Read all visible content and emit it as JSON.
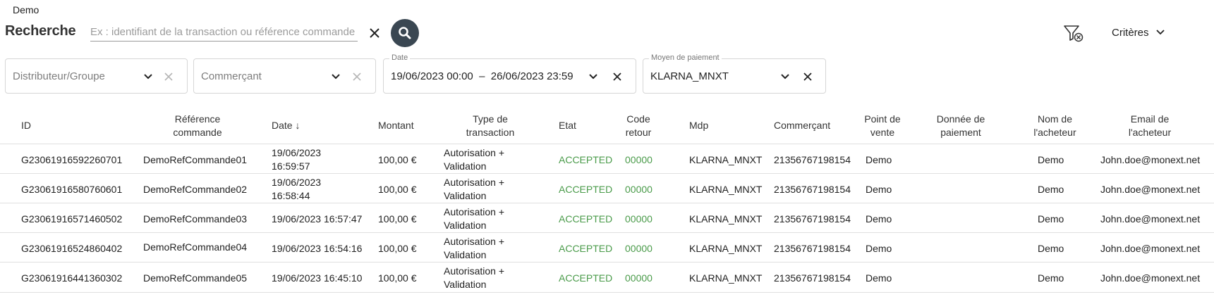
{
  "app": {
    "title": "Demo"
  },
  "search": {
    "label": "Recherche",
    "placeholder": "Ex : identifiant de la transaction ou référence commande",
    "value": ""
  },
  "toolbar": {
    "criteria_label": "Critères"
  },
  "filters": {
    "distributor": {
      "placeholder": "Distributeur/Groupe"
    },
    "merchant": {
      "placeholder": "Commerçant"
    },
    "date": {
      "label": "Date",
      "value": "19/06/2023 00:00  –  26/06/2023 23:59"
    },
    "payment": {
      "label": "Moyen de paiement",
      "value": "KLARNA_MNXT"
    }
  },
  "table": {
    "headers": {
      "id": "ID",
      "ref": "Référence commande",
      "date": "Date ↓",
      "amount": "Montant",
      "type": "Type de transaction",
      "state": "Etat",
      "code": "Code retour",
      "mdp": "Mdp",
      "merchant": "Commerçant",
      "pos": "Point de vente",
      "paydata": "Donnée de paiement",
      "buyer": "Nom de l'acheteur",
      "email": "Email de l'acheteur"
    },
    "rows": [
      {
        "id": "G23061916592260701",
        "ref": "DemoRefCommande01",
        "date": "19/06/2023 16:59:57",
        "date_l1": "19/06/2023",
        "date_l2": "16:59:57",
        "amount": "100,00 €",
        "type_l1": "Autorisation +",
        "type_l2": "Validation",
        "state": "ACCEPTED",
        "code": "00000",
        "mdp": "KLARNA_MNXT",
        "merchant": "21356767198154",
        "pos": "Demo",
        "buyer": "Demo",
        "email": "John.doe@monext.net"
      },
      {
        "id": "G23061916580760601",
        "ref": "DemoRefCommande02",
        "date": "19/06/2023 16:58:44",
        "date_l1": "19/06/2023",
        "date_l2": "16:58:44",
        "amount": "100,00 €",
        "type_l1": "Autorisation +",
        "type_l2": "Validation",
        "state": "ACCEPTED",
        "code": "00000",
        "mdp": "KLARNA_MNXT",
        "merchant": "21356767198154",
        "pos": "Demo",
        "buyer": "Demo",
        "email": "John.doe@monext.net"
      },
      {
        "id": "G23061916571460502",
        "ref": "DemoRefCommande03",
        "date": "19/06/2023 16:57:47",
        "amount": "100,00 €",
        "type_l1": "Autorisation +",
        "type_l2": "Validation",
        "state": "ACCEPTED",
        "code": "00000",
        "mdp": "KLARNA_MNXT",
        "merchant": "21356767198154",
        "pos": "Demo",
        "buyer": "Demo",
        "email": "John.doe@monext.net"
      },
      {
        "id": "G23061916524860402",
        "ref": "DemoRefCommande04",
        "date": "19/06/2023 16:54:16",
        "amount": "100,00 €",
        "type_l1": "Autorisation +",
        "type_l2": "Validation",
        "state": "ACCEPTED",
        "code": "00000",
        "mdp": "KLARNA_MNXT",
        "merchant": "21356767198154",
        "pos": "Demo",
        "buyer": "Demo",
        "email": "John.doe@monext.net"
      },
      {
        "id": "G23061916441360302",
        "ref": "DemoRefCommande05",
        "date": "19/06/2023 16:45:10",
        "amount": "100,00 €",
        "type_l1": "Autorisation +",
        "type_l2": "Validation",
        "state": "ACCEPTED",
        "code": "00000",
        "mdp": "KLARNA_MNXT",
        "merchant": "21356767198154",
        "pos": "Demo",
        "buyer": "Demo",
        "email": "John.doe@monext.net"
      }
    ]
  },
  "colors": {
    "accent_dark": "#3a4752",
    "status_ok": "#4a9b4a",
    "border": "#d6d6d6"
  },
  "icons": {
    "search": "magnifier-icon",
    "clear": "close-icon",
    "filter_clear": "filter-clear-icon",
    "chevron": "chevron-down-icon"
  }
}
